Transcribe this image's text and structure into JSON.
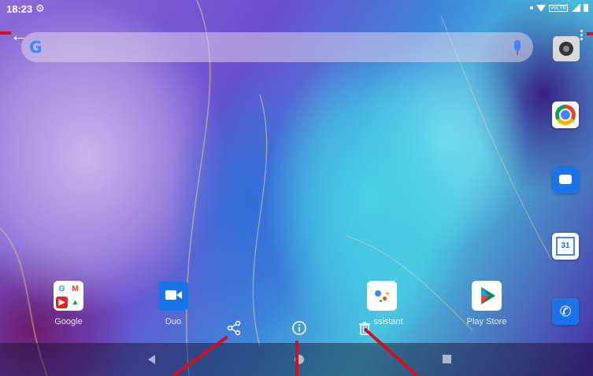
{
  "status_bar": {
    "time": "18:23",
    "icons": [
      "settings-icon",
      "wifi-icon",
      "volte-icon",
      "signal-icon",
      "battery-icon"
    ],
    "volte_text": "VoLTE"
  },
  "search": {
    "logo": "G",
    "icons": [
      "google-logo",
      "mic-icon",
      "camera-icon"
    ]
  },
  "dock_right": [
    {
      "name": "Chrome",
      "icon": "chrome-icon"
    },
    {
      "name": "Messages",
      "icon": "messages-icon"
    },
    {
      "name": "Calendar",
      "icon": "calendar-icon",
      "text": "31"
    },
    {
      "name": "Phone",
      "icon": "phone-icon"
    }
  ],
  "home_apps": [
    {
      "label": "Google",
      "icon": "google-folder-icon",
      "folder": [
        "G",
        "M",
        "▶",
        "▲"
      ]
    },
    {
      "label": "Duo",
      "icon": "duo-icon"
    },
    {
      "label": "Assistant",
      "label_visible": "ssistant",
      "icon": "assistant-icon"
    },
    {
      "label": "Play Store",
      "icon": "play-store-icon"
    }
  ],
  "actions": [
    {
      "name": "share",
      "icon": "share-icon"
    },
    {
      "name": "info",
      "icon": "info-icon"
    },
    {
      "name": "delete",
      "icon": "trash-icon"
    }
  ],
  "nav": [
    "back",
    "home",
    "recents"
  ],
  "colors": {
    "annotation_red": "#d01020",
    "google_blue": "#4285f4",
    "app_blue": "#1a73e8"
  }
}
